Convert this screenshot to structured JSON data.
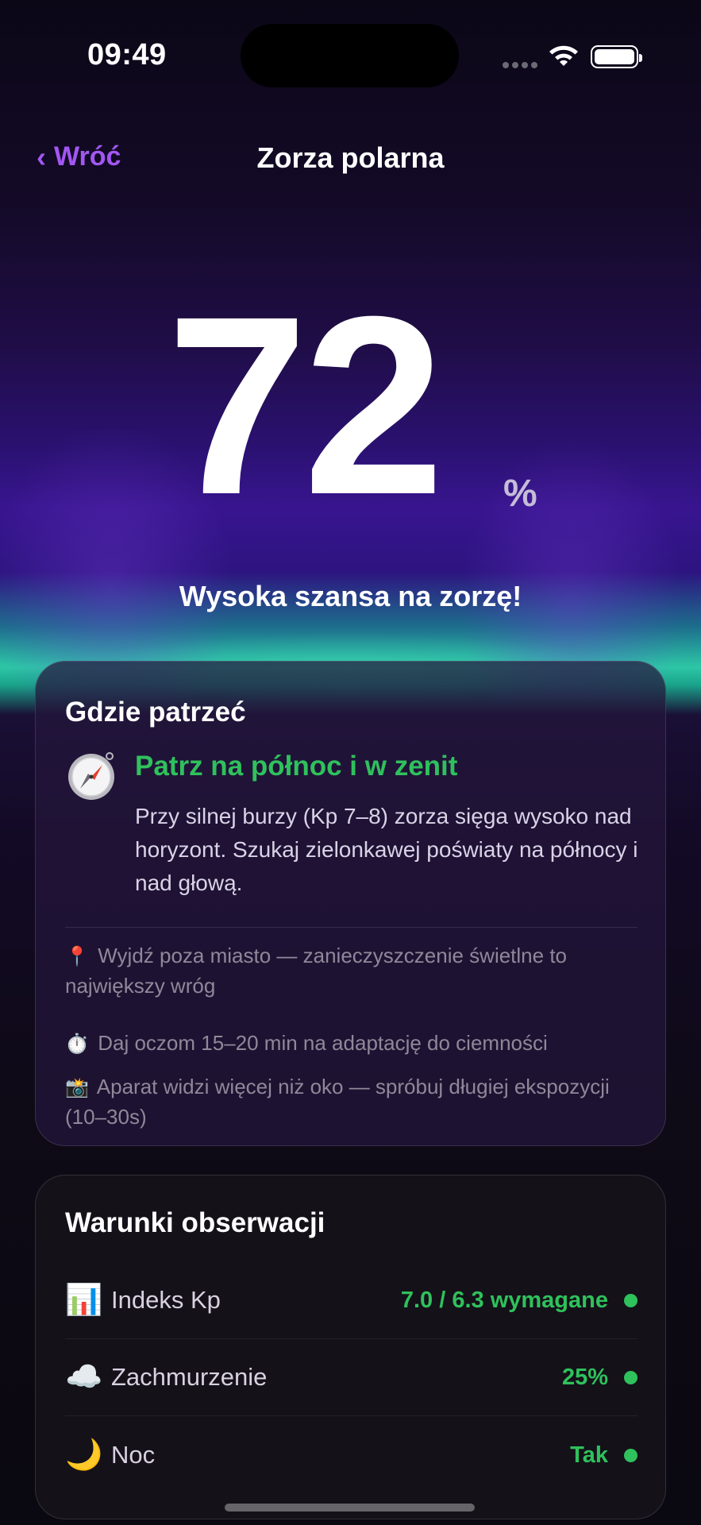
{
  "status_bar": {
    "time": "09:49"
  },
  "nav": {
    "back_label": "Wróć",
    "title": "Zorza polarna"
  },
  "probability": {
    "value": "72",
    "unit": "%",
    "message": "Wysoka szansa na zorzę!"
  },
  "where_to_look": {
    "title": "Gdzie patrzeć",
    "direction_icon": "compass-icon",
    "direction": "Patrz na północ i w zenit",
    "description": "Przy silnej burzy (Kp 7–8) zorza sięga wysoko nad horyzont. Szukaj zielonkawej poświaty na północy i nad głową.",
    "tips": [
      {
        "icon": "📍",
        "icon_name": "pin-icon",
        "text": "Wyjdź poza miasto — zanieczyszczenie świetlne to największy wróg"
      },
      {
        "icon": "⏱️",
        "icon_name": "stopwatch-icon",
        "text": "Daj oczom 15–20 min na adaptację do ciemności"
      },
      {
        "icon": "📸",
        "icon_name": "camera-flash-icon",
        "text": "Aparat widzi więcej niż oko — spróbuj długiej ekspozycji (10–30s)"
      }
    ]
  },
  "conditions": {
    "title": "Warunki obserwacji",
    "rows": [
      {
        "icon": "📊",
        "icon_name": "bar-chart-icon",
        "label": "Indeks Kp",
        "value": "7.0 / 6.3 wymagane",
        "status_color": "#2fc15c"
      },
      {
        "icon": "☁️",
        "icon_name": "cloud-icon",
        "label": "Zachmurzenie",
        "value": "25%",
        "status_color": "#2fc15c"
      },
      {
        "icon": "🌙",
        "icon_name": "moon-icon",
        "label": "Noc",
        "value": "Tak",
        "status_color": "#2fc15c"
      }
    ]
  },
  "colors": {
    "accent": "#a257f2",
    "positive": "#2fc15c"
  }
}
